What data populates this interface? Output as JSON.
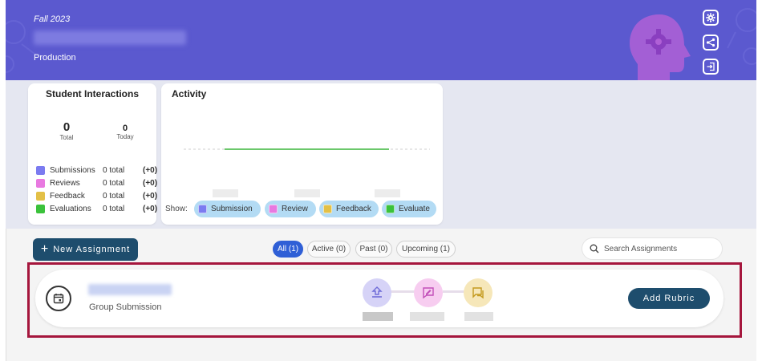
{
  "header": {
    "term": "Fall 2023",
    "section": "Production",
    "colors": {
      "banner": "#5b59cf",
      "accent_dark": "#1e4d6d",
      "highlight": "#a5163d"
    },
    "buttons": [
      {
        "name": "settings-button",
        "icon": "gear-icon"
      },
      {
        "name": "share-button",
        "icon": "share-icon"
      },
      {
        "name": "exit-button",
        "icon": "sign-out-icon"
      }
    ]
  },
  "student_interactions": {
    "title": "Student Interactions",
    "total": {
      "value": "0",
      "label": "Total"
    },
    "today": {
      "value": "0",
      "label": "Today"
    },
    "legend": [
      {
        "name": "Submissions",
        "total": "0 total",
        "delta": "(+0)",
        "color": "#7b7bf0"
      },
      {
        "name": "Reviews",
        "total": "0 total",
        "delta": "(+0)",
        "color": "#e879e0"
      },
      {
        "name": "Feedback",
        "total": "0 total",
        "delta": "(+0)",
        "color": "#e3c047"
      },
      {
        "name": "Evaluations",
        "total": "0 total",
        "delta": "(+0)",
        "color": "#3bc23b"
      }
    ]
  },
  "activity": {
    "title": "Activity",
    "show_label": "Show:",
    "filters": [
      {
        "label": "Submission",
        "color": "#7b7bf0"
      },
      {
        "label": "Review",
        "color": "#e879e0"
      },
      {
        "label": "Feedback",
        "color": "#e3c047"
      },
      {
        "label": "Evaluate",
        "color": "#3bc23b"
      }
    ],
    "line_color": "#3ab53a"
  },
  "toolbar": {
    "new_assignment": "New Assignment",
    "tabs": [
      {
        "label": "All (1)",
        "active": true
      },
      {
        "label": "Active (0)",
        "active": false
      },
      {
        "label": "Past (0)",
        "active": false
      },
      {
        "label": "Upcoming (1)",
        "active": false
      }
    ],
    "search_placeholder": "Search Assignments"
  },
  "assignment": {
    "type": "Group Submission",
    "steps": [
      {
        "icon": "upload-icon",
        "color": "#d6d3f7"
      },
      {
        "icon": "review-icon",
        "color": "#f7cdf0"
      },
      {
        "icon": "feedback-icon",
        "color": "#f6e7b9"
      }
    ],
    "action": "Add Rubric"
  }
}
